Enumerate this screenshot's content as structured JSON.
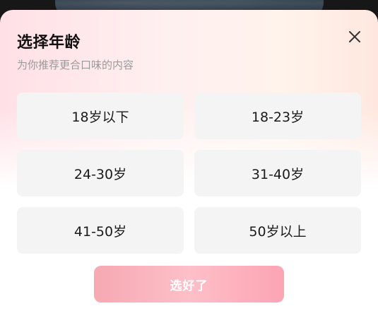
{
  "header": {
    "title": "选择年龄",
    "subtitle": "为你推荐更合口味的内容"
  },
  "options": [
    {
      "label": "18岁以下"
    },
    {
      "label": "18-23岁"
    },
    {
      "label": "24-30岁"
    },
    {
      "label": "31-40岁"
    },
    {
      "label": "41-50岁"
    },
    {
      "label": "50岁以上"
    }
  ],
  "confirm": {
    "label": "选好了"
  },
  "icons": {
    "close": "close-icon"
  },
  "colors": {
    "option_bg": "#f4f4f4",
    "confirm_gradient_start": "#f6a9b2",
    "confirm_gradient_end": "#fda4b3",
    "title": "#111111",
    "subtitle": "#9a9a9a"
  }
}
